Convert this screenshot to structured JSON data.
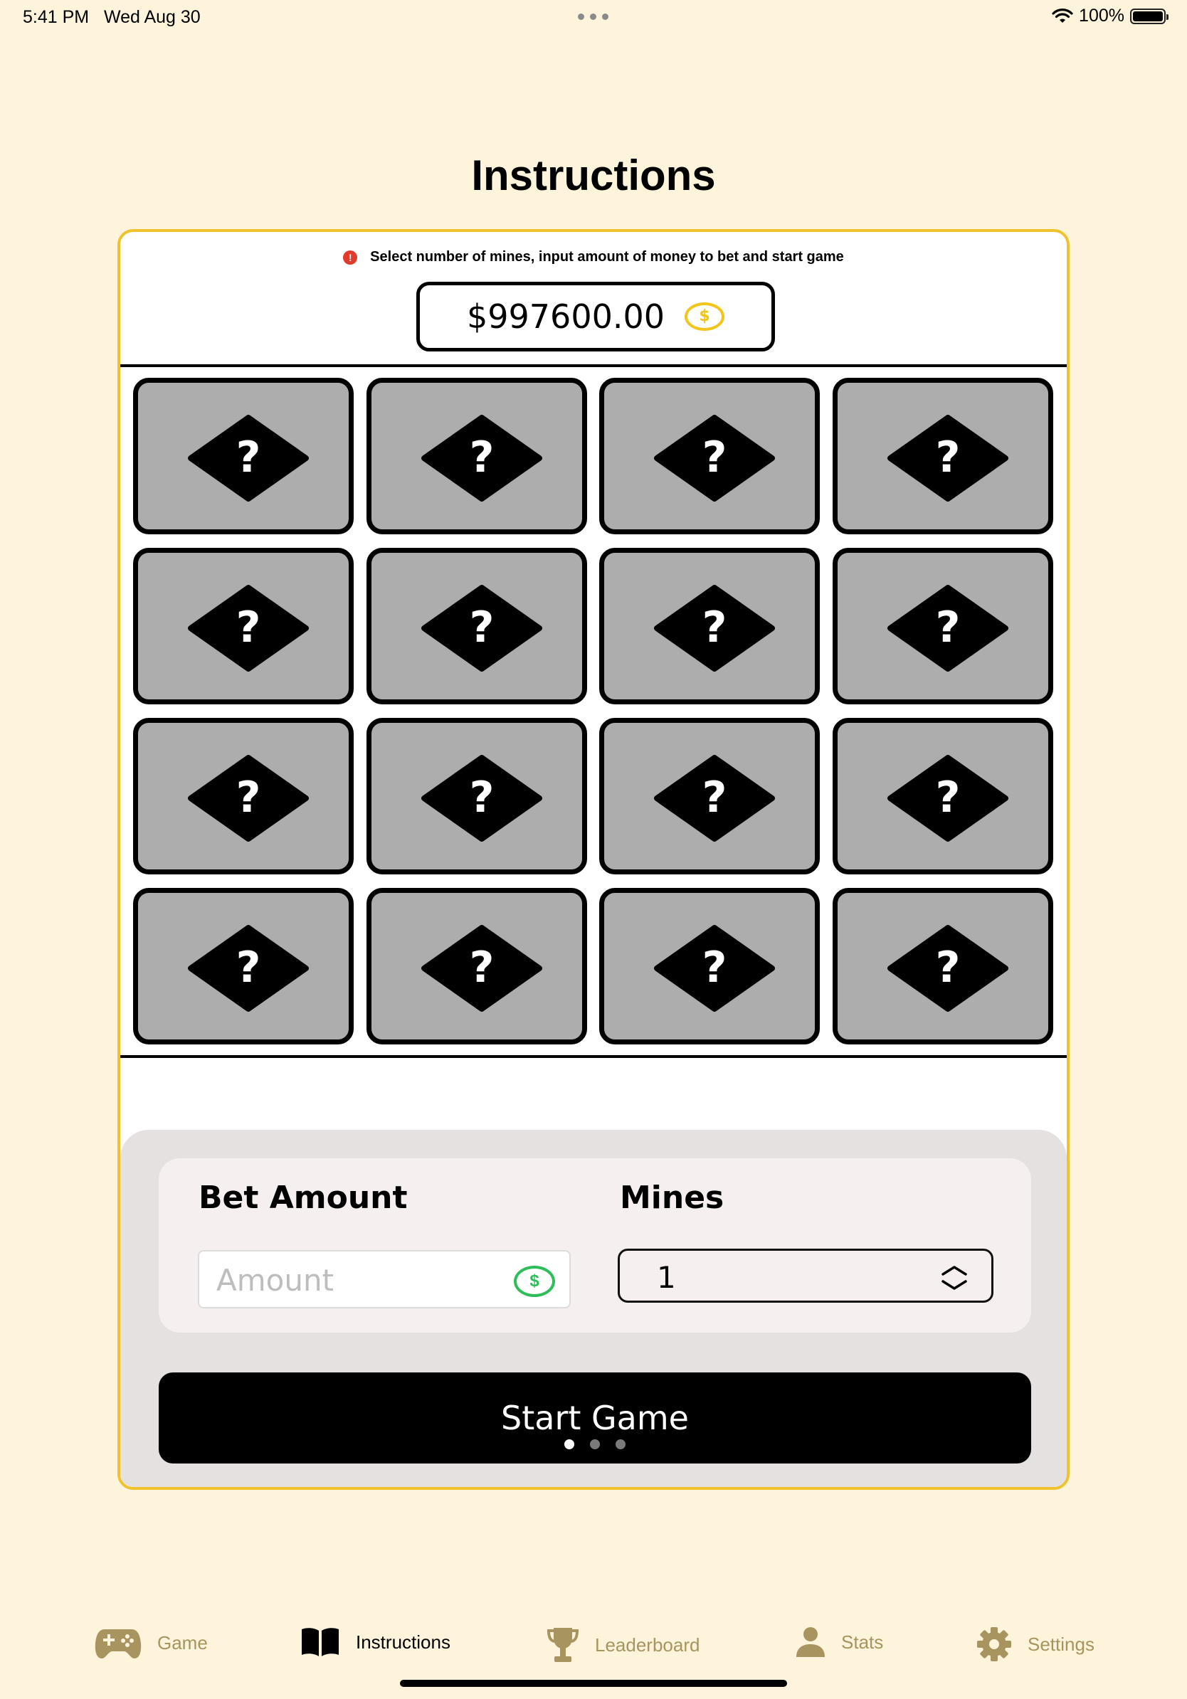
{
  "status_bar": {
    "time": "5:41 PM",
    "date": "Wed Aug 30",
    "battery": "100%",
    "battery_level": 1.0
  },
  "page": {
    "title": "Instructions"
  },
  "preview": {
    "hint": "Select number of mines, input amount of money to bet and start game",
    "balance": "$997600.00",
    "currency_symbol": "$",
    "tile_symbol": "?",
    "tile_rows": 4,
    "tile_cols": 4,
    "bet_label": "Bet Amount",
    "amount_placeholder": "Amount",
    "mines_label": "Mines",
    "mines_value": "1",
    "start_button": "Start Game",
    "page_indicator": {
      "count": 3,
      "current": 1
    }
  },
  "tabs": [
    {
      "label": "Game",
      "icon": "gamepad-icon",
      "active": false
    },
    {
      "label": "Instructions",
      "icon": "book-icon",
      "active": true
    },
    {
      "label": "Leaderboard",
      "icon": "trophy-icon",
      "active": false
    },
    {
      "label": "Stats",
      "icon": "person-icon",
      "active": false
    },
    {
      "label": "Settings",
      "icon": "gear-icon",
      "active": false
    }
  ],
  "colors": {
    "background": "#FEF4DC",
    "frame_border": "#F0C22C",
    "tile_fill": "#ADADAD",
    "coin_gold": "#F2C519",
    "coin_green": "#2DBE5A",
    "tab_inactive": "#A7945E",
    "info_red": "#E23B2E"
  }
}
